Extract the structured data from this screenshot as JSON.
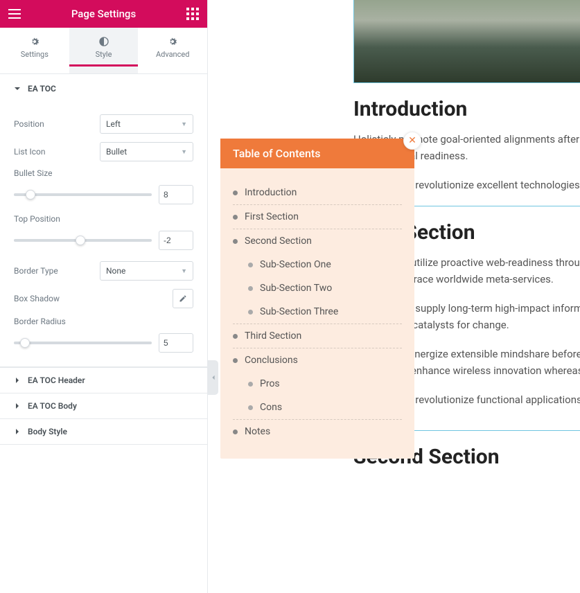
{
  "header": {
    "title": "Page Settings"
  },
  "tabs": {
    "settings": "Settings",
    "style": "Style",
    "advanced": "Advanced"
  },
  "section": {
    "main_title": "EA TOC",
    "position_label": "Position",
    "position_value": "Left",
    "listicon_label": "List Icon",
    "listicon_value": "Bullet",
    "bulletsize_label": "Bullet Size",
    "bulletsize_value": "8",
    "topposition_label": "Top Position",
    "topposition_value": "-2",
    "bordertype_label": "Border Type",
    "bordertype_value": "None",
    "boxshadow_label": "Box Shadow",
    "borderradius_label": "Border Radius",
    "borderradius_value": "5",
    "header2": "EA TOC Header",
    "header3": "EA TOC Body",
    "header4": "Body Style"
  },
  "toc": {
    "title": "Table of Contents",
    "items": {
      "intro": "Introduction",
      "first": "First Section",
      "second": "Second Section",
      "sub1": "Sub-Section One",
      "sub2": "Sub-Section Two",
      "sub3": "Sub-Section Three",
      "third": "Third Section",
      "conclusions": "Conclusions",
      "pros": "Pros",
      "cons": "Cons",
      "notes": "Notes"
    }
  },
  "article": {
    "h_intro": "Introduction",
    "p1": "Holisticly promote goal-oriented alignments after premium results before real-time content. Credibly maximize real readiness.",
    "p2": "Conveniently revolutionize excellent technologies and orchestrate multimedia based interfaces before.",
    "h_first": "First Section",
    "p3": "Continually utilize proactive web-readiness through human capital and alternative internal sources. Quickly embrace worldwide meta-services.",
    "p4": "Dynamically supply long-term high-impact information and reinvent orthogonal benefits whereas transparent catalysts for change.",
    "p5": "Efficiently synergize extensible mindshare before. Globally engineer excellent metrics without best. Continually enhance wireless innovation whereas.",
    "p6": "Dynamically revolutionize functional applications.",
    "h_second": "Second Section"
  }
}
